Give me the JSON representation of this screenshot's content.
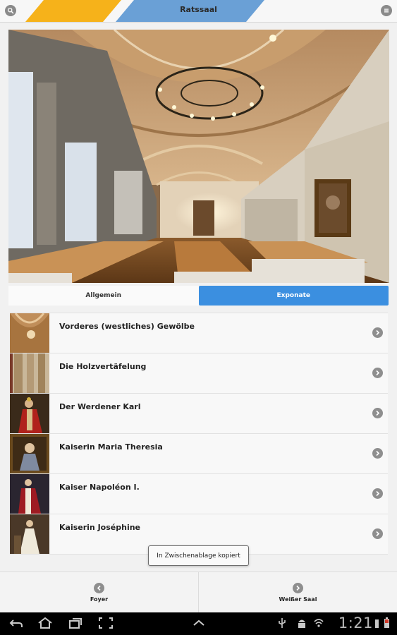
{
  "header": {
    "title": "Ratssaal",
    "left_icon": "zoom-icon",
    "right_icon": "menu-icon",
    "accent_yellow": "#f6b21a",
    "accent_blue": "#6aa0d6"
  },
  "tabs": [
    {
      "label": "Allgemein",
      "active": false
    },
    {
      "label": "Exponate",
      "active": true
    }
  ],
  "list": {
    "items": [
      {
        "label": "Vorderes (westliches) Gewölbe",
        "thumb": "ceiling-image"
      },
      {
        "label": "Die Holzvertäfelung",
        "thumb": "paneling-image"
      },
      {
        "label": "Der Werdener Karl",
        "thumb": "karl-portrait"
      },
      {
        "label": "Kaiserin Maria Theresia",
        "thumb": "maria-theresia-portrait"
      },
      {
        "label": "Kaiser Napoléon I.",
        "thumb": "napoleon-portrait"
      },
      {
        "label": "Kaiserin Joséphine",
        "thumb": "josephine-portrait"
      }
    ]
  },
  "toast": {
    "text": "In Zwischenablage kopiert"
  },
  "bottom_nav": {
    "prev_label": "Foyer",
    "next_label": "Weißer Saal"
  },
  "system_bar": {
    "time": "1:21"
  }
}
